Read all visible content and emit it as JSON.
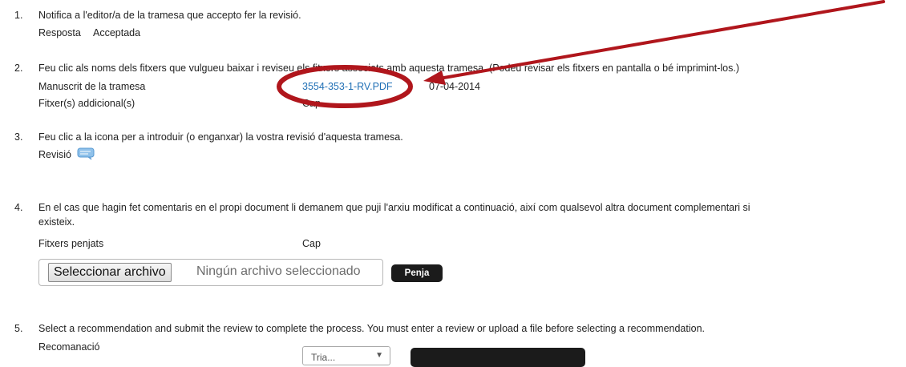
{
  "steps": [
    {
      "number": "1.",
      "text": "Notifica a l'editor/a de la tramesa que accepto fer la revisió.",
      "response_label": "Resposta",
      "response_value": "Acceptada"
    },
    {
      "number": "2.",
      "text": "Feu clic als noms dels fitxers que vulgueu baixar i reviseu els fitxers associats amb aquesta tramesa. (Podeu revisar els fitxers en pantalla o bé imprimint-los.)",
      "manuscript_label": "Manuscrit de la tramesa",
      "manuscript_file": "3554-353-1-RV.PDF",
      "manuscript_date": "07-04-2014",
      "additional_label": "Fitxer(s) addicional(s)",
      "additional_value": "Cap"
    },
    {
      "number": "3.",
      "text": "Feu clic a la icona per a introduir (o enganxar) la vostra revisió d'aquesta tramesa.",
      "review_label": "Revisió",
      "review_icon": "comment-icon"
    },
    {
      "number": "4.",
      "text_line1": "En el cas que hagin fet comentaris en el propi document li demanem que puji l'arxiu modificat a continuació, així com qualsevol altra document complementari si",
      "text_line2": "existeix.",
      "uploaded_label": "Fitxers penjats",
      "uploaded_value": "Cap",
      "file_button": "Seleccionar archivo",
      "file_status": "Ningún archivo seleccionado",
      "upload_button": "Penja"
    },
    {
      "number": "5.",
      "text": "Select a recommendation and submit the review to complete the process. You must enter a review or upload a file before selecting a recommendation.",
      "recommendation_label": "Recomanació",
      "select_value": "Tria..."
    }
  ],
  "colors": {
    "link": "#1f6fb5",
    "annotation": "#b0161c",
    "dark_button": "#1b1b1b",
    "icon": "#8fc1ea"
  }
}
